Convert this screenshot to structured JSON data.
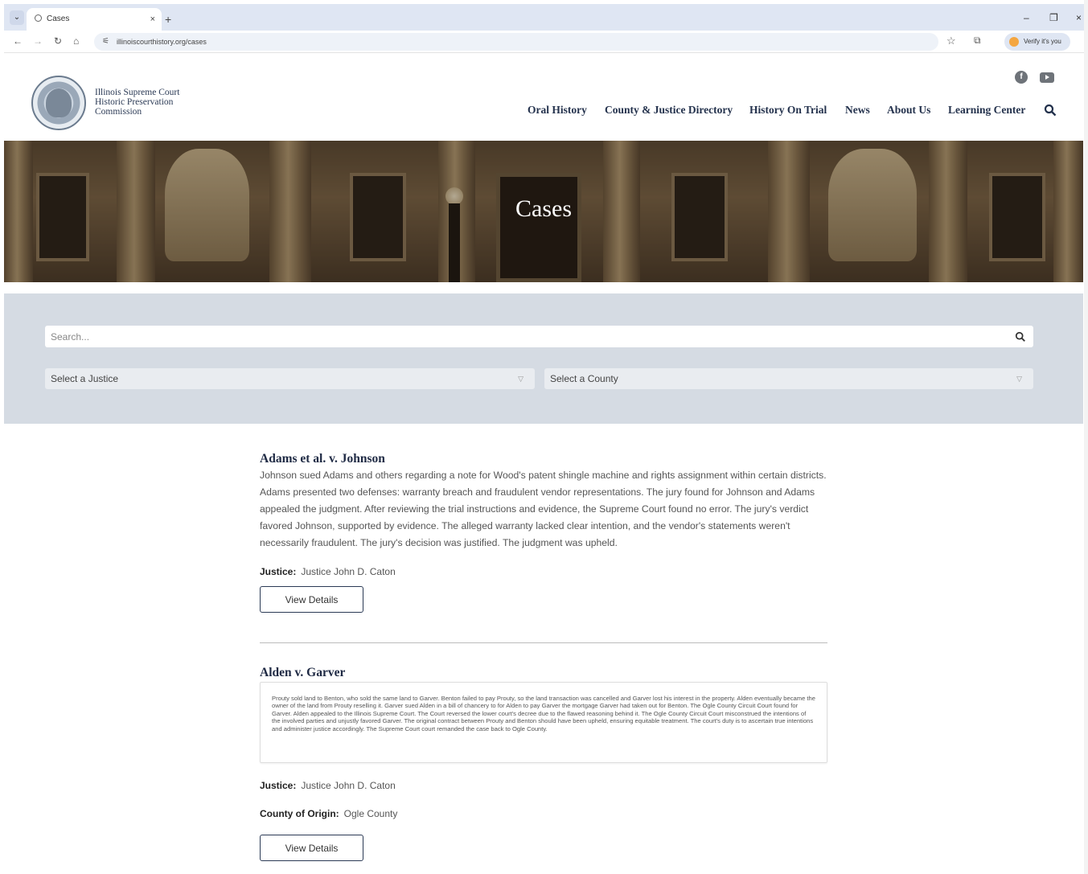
{
  "browser": {
    "tab_title": "Cases",
    "tab_close": "×",
    "new_tab": "+",
    "url": "illinoiscourthistory.org/cases",
    "verify_label": "Verify it's you",
    "minimize": "–",
    "restore": "❐",
    "close": "×"
  },
  "site": {
    "org_name": "Illinois Supreme Court\nHistoric Preservation\nCommission",
    "nav": [
      "Oral History",
      "County & Justice Directory",
      "History On Trial",
      "News",
      "About Us",
      "Learning Center"
    ]
  },
  "hero": {
    "title": "Cases"
  },
  "filters": {
    "search_placeholder": "Search...",
    "justice_select": "Select a Justice",
    "county_select": "Select a County"
  },
  "cases": [
    {
      "title": "Adams et al. v. Johnson",
      "summary": "Johnson sued Adams and others regarding a note for Wood's patent shingle machine and rights assignment within certain districts. Adams presented two defenses: warranty breach and fraudulent vendor representations. The jury found for Johnson and Adams appealed the judgment. After reviewing the trial instructions and evidence, the Supreme Court found no error. The jury's verdict favored Johnson, supported by evidence. The alleged warranty lacked clear intention, and the vendor's statements weren't necessarily fraudulent. The jury's decision was justified. The judgment was upheld.",
      "justice_label": "Justice:",
      "justice": "Justice John D. Caton",
      "button": "View Details"
    },
    {
      "title": "Alden v. Garver",
      "summary": "Prouty sold land to Benton, who sold the same land to Garver. Benton failed to pay Prouty, so the land transaction was cancelled and Garver lost his interest in the property. Alden eventually became the owner of the land from Prouty reselling it. Garver sued Alden in a bill of chancery to for Alden to pay Garver the mortgage Garver had taken out for Benton. The Ogle County Circuit Court found for Garver. Alden appealed to the Illinois Supreme Court. The Court reversed the lower court's decree due to the flawed reasoning behind it. The Ogle County Circuit Court misconstrued the intentions of the involved parties and unjustly favored Garver. The original contract between Prouty and Benton should have been upheld, ensuring equitable treatment. The court's duty is to ascertain true intentions and administer justice accordingly. The Supreme Court court remanded the case back to Ogle County.",
      "justice_label": "Justice:",
      "justice": "Justice John D. Caton",
      "county_label": "County of Origin:",
      "county": "Ogle County",
      "button": "View Details"
    }
  ],
  "icons": {
    "facebook": "facebook-icon",
    "youtube": "youtube-icon",
    "search": "search-icon"
  },
  "colors": {
    "nav_text": "#24324d",
    "filter_band": "#d5dbe3",
    "button_border": "#2b3a55"
  }
}
